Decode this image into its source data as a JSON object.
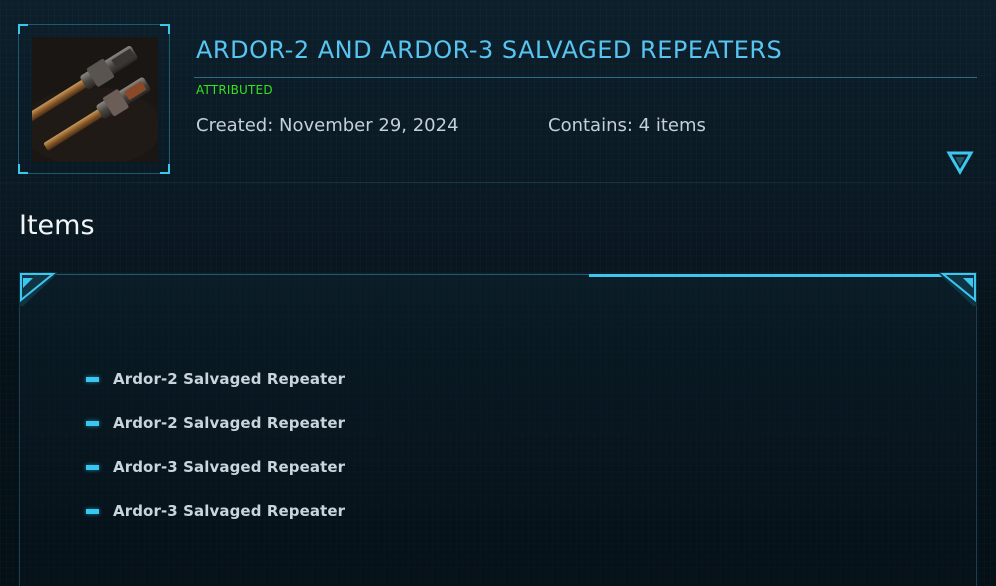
{
  "package": {
    "title": "ARDOR-2 AND ARDOR-3 SALVAGED REPEATERS",
    "status": "ATTRIBUTED",
    "created": "Created: November 29, 2024",
    "contains": "Contains: 4 items",
    "thumbnail_icon": "weapon-thumbnail",
    "expand_icon": "chevron-down-icon"
  },
  "items_section": {
    "title": "Items",
    "items": [
      {
        "label": "Ardor-2 Salvaged Repeater"
      },
      {
        "label": "Ardor-2 Salvaged Repeater"
      },
      {
        "label": "Ardor-3 Salvaged Repeater"
      },
      {
        "label": "Ardor-3 Salvaged Repeater"
      }
    ]
  },
  "colors": {
    "accent": "#3bc7ef",
    "title": "#58c4f0",
    "status": "#36e21c",
    "background": "#0a1a24"
  }
}
